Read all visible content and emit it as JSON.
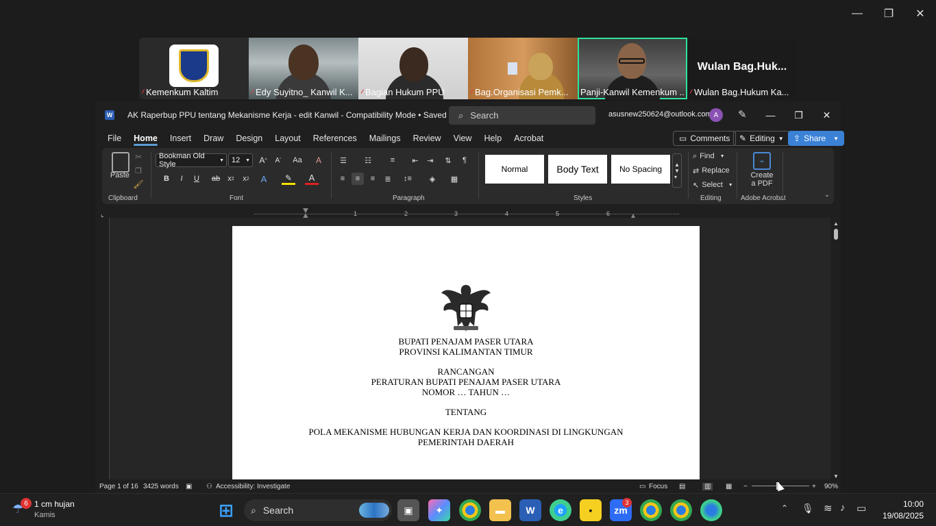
{
  "zoom_window": {
    "minimize": "—",
    "restore": "❐",
    "close": "✕"
  },
  "participants": [
    {
      "name": "Kemenkum Kaltim"
    },
    {
      "name": "Edy Suyitno_ Kanwil K..."
    },
    {
      "name": "Bagian Hukum PPU"
    },
    {
      "name": "Bag.Organisasi Pemk..."
    },
    {
      "name": "Panji-Kanwil Kemenkum ..."
    },
    {
      "name": "Wulan Bag.Hukum Ka...",
      "display_name": "Wulan  Bag.Huk..."
    }
  ],
  "word": {
    "title": "AK Raperbup PPU tentang Mekanisme Kerja - edit Kanwil  -  Compatibility Mode • Saved",
    "search_placeholder": "Search",
    "account": "asusnew250624@outlook.com",
    "avatar_letter": "A",
    "menu": [
      "File",
      "Home",
      "Insert",
      "Draw",
      "Design",
      "Layout",
      "References",
      "Mailings",
      "Review",
      "View",
      "Help",
      "Acrobat"
    ],
    "active_menu": "Home",
    "comments_label": "Comments",
    "editing_label": "Editing",
    "share_label": "Share",
    "ribbon": {
      "paste": "Paste",
      "clipboard": "Clipboard",
      "font_name": "Bookman Old Style",
      "font_size": "12",
      "font_group": "Font",
      "paragraph_group": "Paragraph",
      "styles": [
        "Normal",
        "Body Text",
        "No Spacing"
      ],
      "styles_group": "Styles",
      "find": "Find",
      "replace": "Replace",
      "select": "Select",
      "editing_group": "Editing",
      "create_pdf_1": "Create",
      "create_pdf_2": "a PDF",
      "acrobat_group": "Adobe Acrobat"
    },
    "ruler_numbers": [
      "1",
      "2",
      "3",
      "4",
      "5",
      "6"
    ],
    "document_lines": {
      "l1": "BUPATI PENAJAM PASER UTARA",
      "l2": "PROVINSI KALIMANTAN TIMUR",
      "l3": "RANCANGAN",
      "l4": "PERATURAN BUPATI PENAJAM PASER UTARA",
      "l5": "NOMOR … TAHUN …",
      "l6": "TENTANG",
      "l7": "POLA MEKANISME HUBUNGAN KERJA DAN KOORDINASI DI LINGKUNGAN",
      "l8": "PEMERINTAH DAERAH"
    },
    "status": {
      "page": "Page 1 of 16",
      "words": "3425 words",
      "accessibility": "Accessibility: Investigate",
      "focus": "Focus",
      "zoom": "90%"
    }
  },
  "taskbar": {
    "weather_temp_badge": "6",
    "weather_line1": "1 cm hujan",
    "weather_line2": "Kamis",
    "search_label": "Search",
    "zoom_badge": "3",
    "time": "10:00",
    "date": "19/08/2025"
  },
  "colors": {
    "accent": "#3b82d6",
    "active_speaker": "#2ee59d",
    "muted": "#e23b3b"
  }
}
